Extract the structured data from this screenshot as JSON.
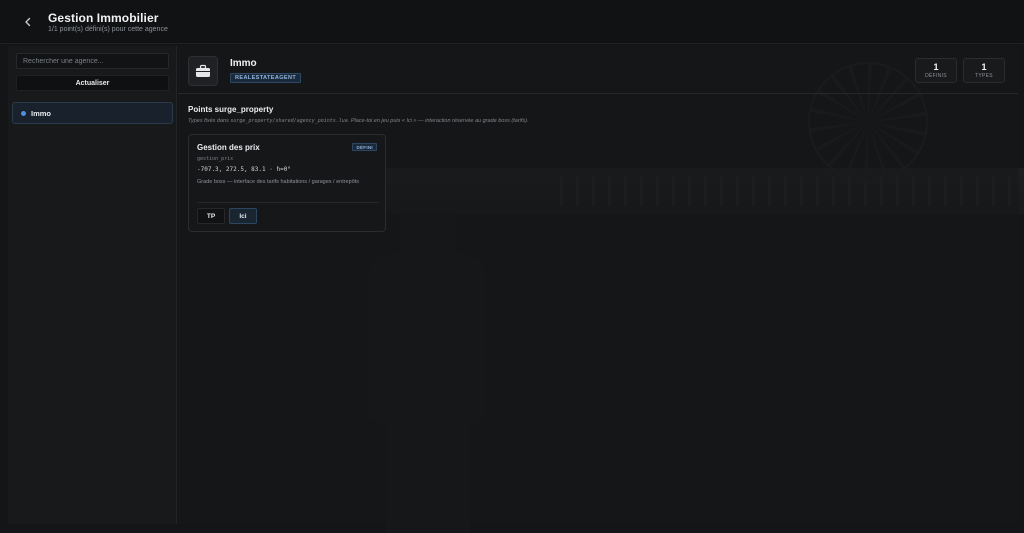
{
  "header": {
    "title": "Gestion Immobilier",
    "subtitle": "1/1 point(s) défini(s) pour cette agence",
    "back_icon": "chevron-left-icon"
  },
  "sidebar": {
    "search_placeholder": "Rechercher une agence...",
    "search_value": "",
    "refresh_label": "Actualiser",
    "agencies": [
      {
        "label": "Immo",
        "selected": true,
        "dot_color": "#4c8fe0"
      }
    ]
  },
  "agency": {
    "icon": "briefcase-icon",
    "name": "Immo",
    "tag": "REALESTATEAGENT",
    "stats": {
      "defined_value": "1",
      "defined_label": "DÉFINIS",
      "types_value": "1",
      "types_label": "TYPES"
    }
  },
  "section": {
    "title": "Points surge_property",
    "desc_before": "Types fixés dans ",
    "desc_code": "surge_property/shared/agency_points.lua",
    "desc_after": ". Place-toi en jeu puis « Ici » — interaction réservée au grade boss (tarifs)."
  },
  "points": [
    {
      "title": "Gestion des prix",
      "badge": "DÉFINI",
      "id": "gestion_prix",
      "coords": "-707.3, 272.5, 83.1 · h=0°",
      "desc": "Grade boss — interface des tarifs habitations / garages / entrepôts",
      "tp_label": "TP",
      "here_label": "Ici"
    }
  ],
  "colors": {
    "accent": "#4c8fe0",
    "badge_text": "#8fb4dc",
    "background": "#141516"
  }
}
